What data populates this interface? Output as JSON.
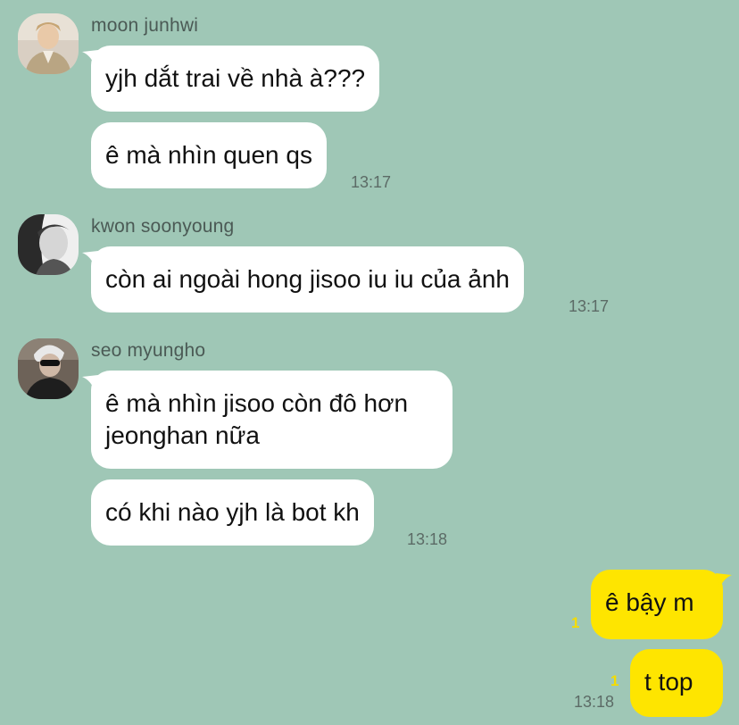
{
  "chat": {
    "groups": [
      {
        "sender": "moon junhwi",
        "messages": [
          "yjh dắt trai về nhà à???",
          "ê mà nhìn quen qs"
        ],
        "time": "13:17"
      },
      {
        "sender": "kwon soonyoung",
        "messages": [
          "còn ai ngoài hong jisoo iu iu của ảnh"
        ],
        "time": "13:17"
      },
      {
        "sender": "seo myungho",
        "messages": [
          "ê mà nhìn jisoo còn đô hơn jeonghan nữa",
          "có khi nào yjh là bot kh"
        ],
        "time": "13:18"
      }
    ],
    "mine": {
      "messages": [
        "ê bậy m",
        "t top"
      ],
      "unread": [
        "1",
        "1"
      ],
      "time": "13:18"
    }
  },
  "colors": {
    "background": "#9fc7b6",
    "incoming_bubble": "#ffffff",
    "outgoing_bubble": "#fee500",
    "unread_count": "#f4dc00"
  }
}
